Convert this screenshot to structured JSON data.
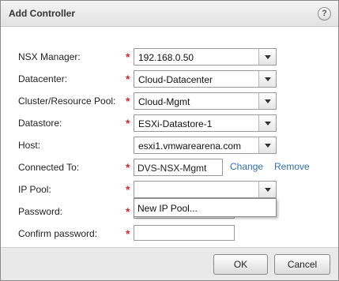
{
  "dialog": {
    "title": "Add Controller",
    "help_icon_glyph": "?"
  },
  "fields": {
    "nsx_manager": {
      "label": "NSX Manager:",
      "value": "192.168.0.50",
      "required": "*"
    },
    "datacenter": {
      "label": "Datacenter:",
      "value": "Cloud-Datacenter",
      "required": "*"
    },
    "cluster": {
      "label": "Cluster/Resource Pool:",
      "value": "Cloud-Mgmt",
      "required": "*"
    },
    "datastore": {
      "label": "Datastore:",
      "value": "ESXi-Datastore-1",
      "required": "*"
    },
    "host": {
      "label": "Host:",
      "value": "esxi1.vmwarearena.com"
    },
    "connected_to": {
      "label": "Connected To:",
      "value": "DVS-NSX-Mgmt",
      "required": "*",
      "change_link": "Change",
      "remove_link": "Remove"
    },
    "ip_pool": {
      "label": "IP Pool:",
      "value": "",
      "required": "*",
      "options": [
        "New IP Pool..."
      ]
    },
    "password": {
      "label": "Password:",
      "required": "*"
    },
    "confirm_password": {
      "label": "Confirm password:",
      "required": "*"
    }
  },
  "buttons": {
    "ok": "OK",
    "cancel": "Cancel"
  },
  "colors": {
    "required_marker": "#d8262d",
    "link": "#2f6fb3",
    "titlebar": "#e8e8e8",
    "footer": "#e9e9e9"
  },
  "icons": {
    "help": "help-icon",
    "dropdown": "chevron-down-icon"
  }
}
